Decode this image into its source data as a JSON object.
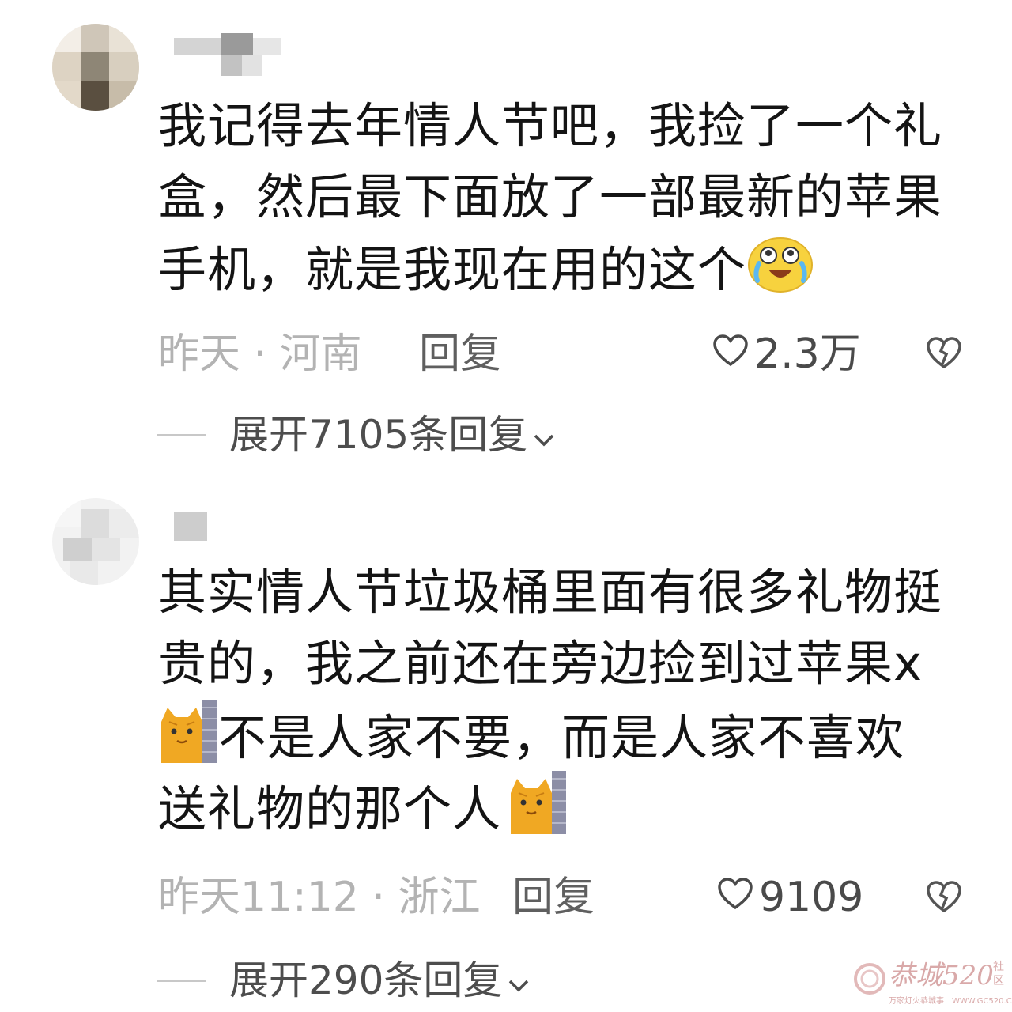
{
  "comments": [
    {
      "text_lines": [
        "我记得去年情人节吧，我捡了一个礼",
        "盒，然后最下面放了一部最新的苹果",
        "手机，就是我现在用的这个"
      ],
      "emoji": "laugh-cry-emoji",
      "meta": "昨天 · 河南",
      "reply_label": "回复",
      "likes": "2.3万",
      "expand": "展开7105条回复"
    },
    {
      "text_lines": [
        "其实情人节垃圾桶里面有很多礼物挺",
        "贵的，我之前还在旁边捡到过苹果x",
        "不是人家不要，而是人家不喜欢",
        "送礼物的那个人"
      ],
      "emoji": "cat-peek-emoji",
      "meta": "昨天11:12 · 浙江",
      "reply_label": "回复",
      "likes": "9109",
      "expand": "展开290条回复"
    }
  ],
  "watermark": {
    "brand": "恭城520",
    "side": "社区",
    "slogan": "万家灯火恭城事",
    "url": "WWW.GC520.CN"
  },
  "colors": {
    "text": "#141414",
    "meta": "#b3b3b3",
    "accent_watermark": "#c0392b"
  }
}
